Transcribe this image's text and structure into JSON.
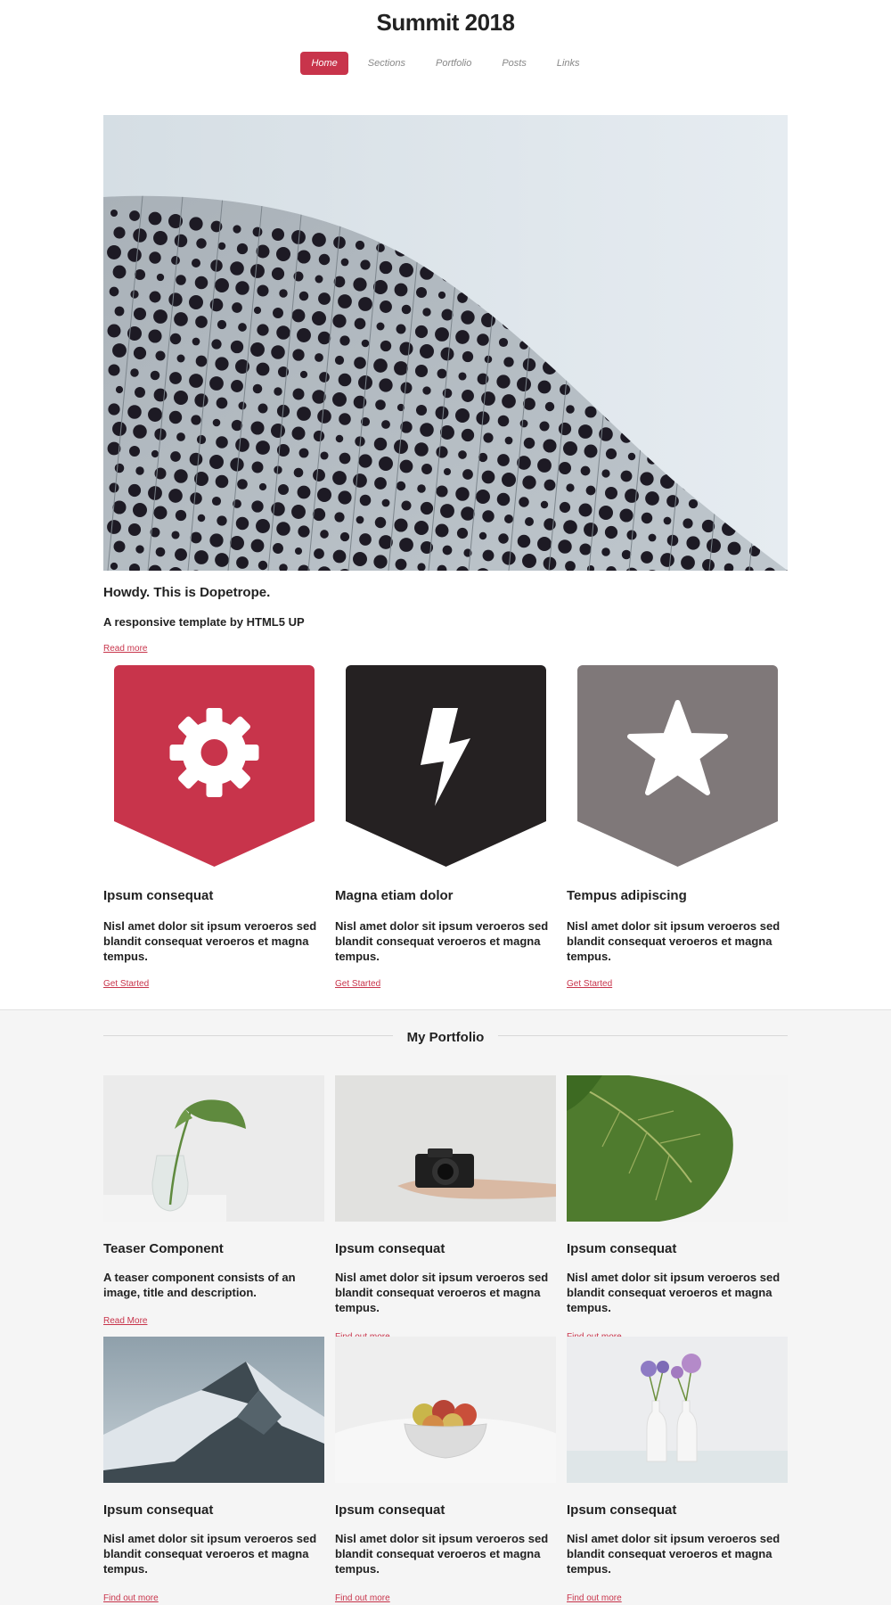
{
  "site": {
    "title": "Summit 2018"
  },
  "nav": {
    "items": [
      "Home",
      "Sections",
      "Portfolio",
      "Posts",
      "Links"
    ],
    "active": "Home"
  },
  "hero": {
    "image": "perforated-building-facade",
    "title": "Howdy. This is Dopetrope.",
    "subtitle": "A responsive template by HTML5 UP",
    "link": "Read more"
  },
  "features": [
    {
      "icon": "gear-icon",
      "color": "#c8344b",
      "title": "Ipsum consequat",
      "text": "Nisl amet dolor sit ipsum veroeros sed blandit consequat veroeros et magna tempus.",
      "link": "Get Started"
    },
    {
      "icon": "lightning-icon",
      "color": "#252122",
      "title": "Magna etiam dolor",
      "text": "Nisl amet dolor sit ipsum veroeros sed blandit consequat veroeros et magna tempus.",
      "link": "Get Started"
    },
    {
      "icon": "star-icon",
      "color": "#7f7879",
      "title": "Tempus adipiscing",
      "text": "Nisl amet dolor sit ipsum veroeros sed blandit consequat veroeros et magna tempus.",
      "link": "Get Started"
    }
  ],
  "portfolio": {
    "heading": "My Portfolio",
    "items": [
      {
        "image": "plant-in-glass-vase",
        "title": "Teaser Component",
        "text": "A teaser component consists of an image, title and description.",
        "link": "Read More"
      },
      {
        "image": "camera-on-hand",
        "title": "Ipsum consequat",
        "text": "Nisl amet dolor sit ipsum veroeros sed blandit consequat veroeros et magna tempus.",
        "link": "Find out more"
      },
      {
        "image": "green-leaf",
        "title": "Ipsum consequat",
        "text": "Nisl amet dolor sit ipsum veroeros sed blandit consequat veroeros et magna tempus.",
        "link": "Find out more"
      },
      {
        "image": "snowy-mountain",
        "title": "Ipsum consequat",
        "text": "Nisl amet dolor sit ipsum veroeros sed blandit consequat veroeros et magna tempus.",
        "link": "Find out more"
      },
      {
        "image": "fruit-bowl",
        "title": "Ipsum consequat",
        "text": "Nisl amet dolor sit ipsum veroeros sed blandit consequat veroeros et magna tempus.",
        "link": "Find out more"
      },
      {
        "image": "flowers-in-vases",
        "title": "Ipsum consequat",
        "text": "Nisl amet dolor sit ipsum veroeros sed blandit consequat veroeros et magna tempus.",
        "link": "Find out more"
      }
    ]
  },
  "colors": {
    "accent": "#c8344b",
    "dark": "#252122",
    "gray": "#7f7879",
    "portfolio_bg": "#f5f5f5"
  }
}
